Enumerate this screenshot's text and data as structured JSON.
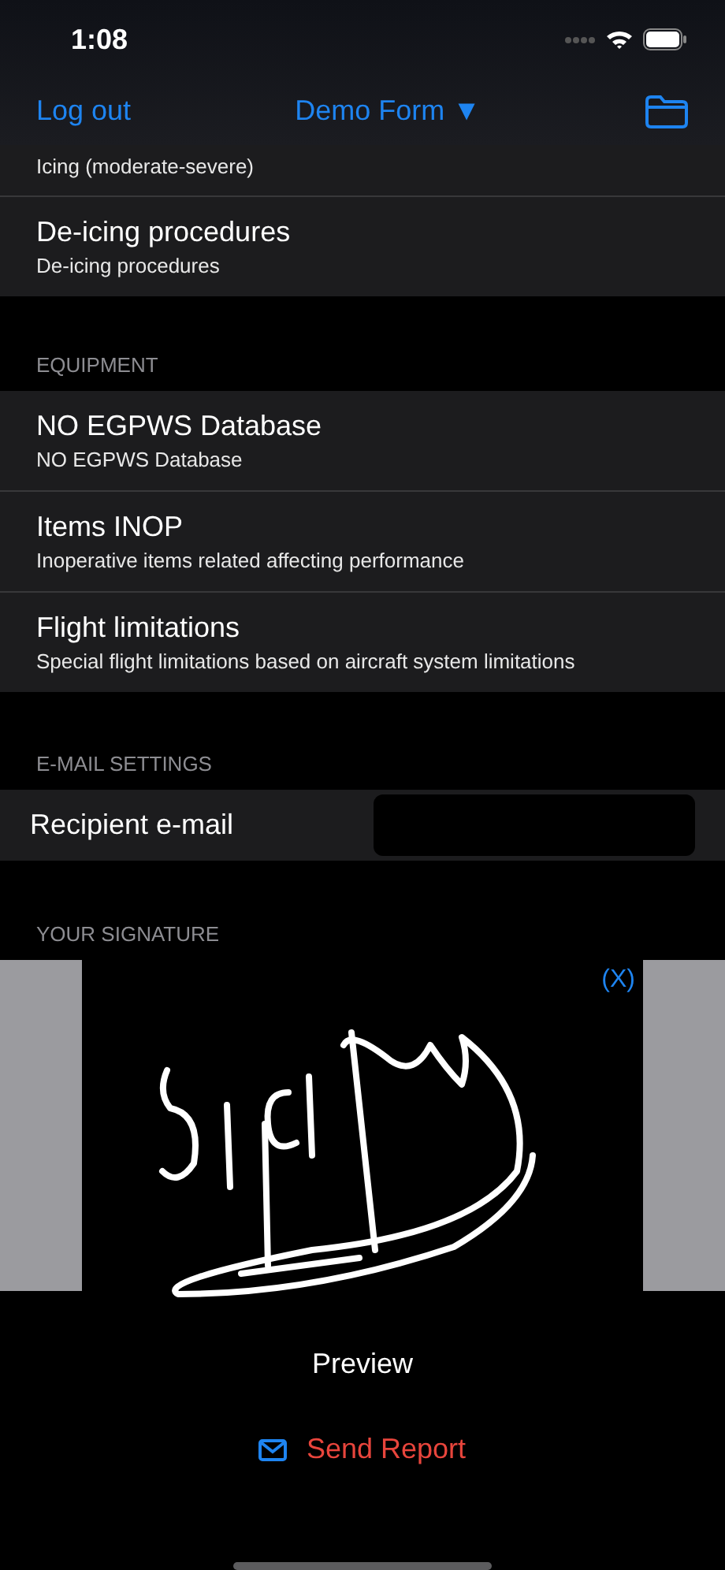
{
  "status_bar": {
    "time": "1:08"
  },
  "nav": {
    "left": "Log out",
    "title": "Demo Form",
    "title_caret": "▼"
  },
  "sections": [
    {
      "rows": [
        {
          "subtitle": "Icing (moderate-severe)"
        },
        {
          "title": "De-icing procedures",
          "subtitle": "De-icing procedures"
        }
      ]
    },
    {
      "header": "EQUIPMENT",
      "rows": [
        {
          "title": "NO EGPWS Database",
          "subtitle": "NO EGPWS Database"
        },
        {
          "title": "Items INOP",
          "subtitle": "Inoperative items related affecting performance"
        },
        {
          "title": "Flight limitations",
          "subtitle": "Special flight limitations based on aircraft system limitations"
        }
      ]
    }
  ],
  "email": {
    "header": "E-MAIL SETTINGS",
    "label": "Recipient e-mail"
  },
  "signature": {
    "header": "YOUR SIGNATURE",
    "clear": "(X)"
  },
  "buttons": [
    {
      "kind": "plain",
      "label": "Preview"
    },
    {
      "kind": "mail",
      "label": "Send Report"
    }
  ]
}
